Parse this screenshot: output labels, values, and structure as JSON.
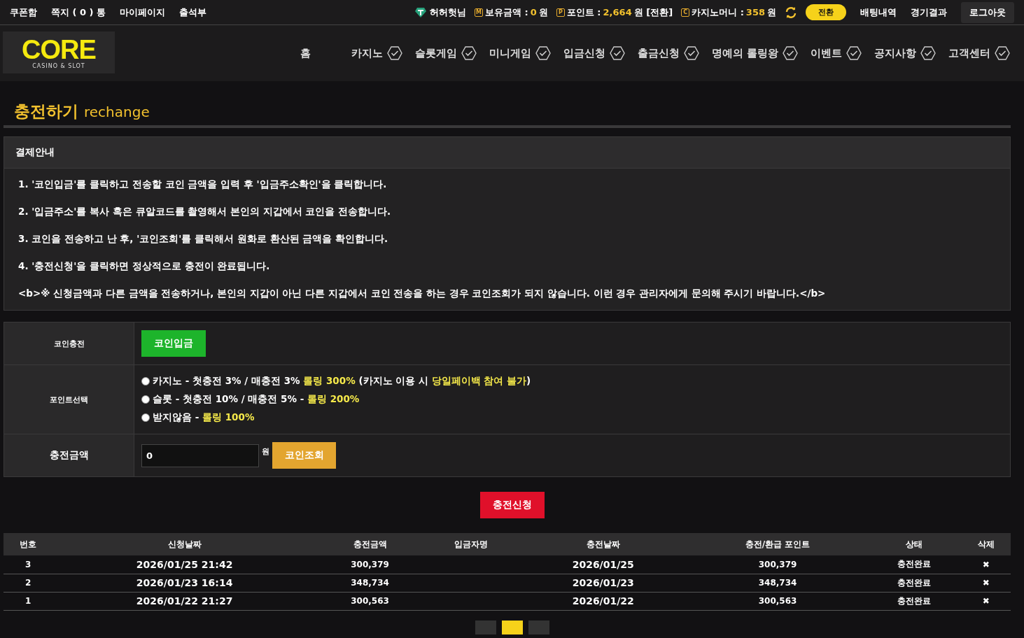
{
  "top_bar": {
    "left_links": [
      "쿠폰함",
      "쪽지 ( 0 ) 통",
      "마이페이지",
      "출석부"
    ],
    "user": {
      "name": "허허헛님"
    },
    "balances": [
      {
        "badge": "M",
        "label": "보유금액 :",
        "value": "0",
        "suffix": "원"
      },
      {
        "badge": "P",
        "label": "포인트 :",
        "value": "2,664",
        "suffix": "원 [전환]"
      },
      {
        "badge": "C",
        "label": "카지노머니 :",
        "value": "358",
        "suffix": "원"
      }
    ],
    "convert_button": "전환",
    "right_links": [
      "배팅내역",
      "경기결과"
    ],
    "logout_button": "로그아웃"
  },
  "logo": {
    "word": "CORE",
    "tagline": "CASINO & SLOT"
  },
  "nav": [
    {
      "label": "홈",
      "has_icon": false
    },
    {
      "label": "카지노",
      "has_icon": true
    },
    {
      "label": "슬롯게임",
      "has_icon": true
    },
    {
      "label": "미니게임",
      "has_icon": true
    },
    {
      "label": "입금신청",
      "has_icon": true
    },
    {
      "label": "출금신청",
      "has_icon": true
    },
    {
      "label": "명예의 롤링왕",
      "has_icon": true
    },
    {
      "label": "이벤트",
      "has_icon": true
    },
    {
      "label": "공지사항",
      "has_icon": true
    },
    {
      "label": "고객센터",
      "has_icon": true
    }
  ],
  "page_title": {
    "main": "충전하기",
    "sub": "rechange"
  },
  "guide": {
    "title": "결제안내",
    "lines": [
      "1. '코인입금'를 클릭하고 전송할 코인 금액을 입력 후 '입금주소확인'을 클릭합니다.",
      "2. '입금주소'를 복사 혹은 큐알코드를 촬영해서 본인의 지갑에서 코인을 전송합니다.",
      "3. 코인을 전송하고 난 후, '코인조회'를 클릭해서 원화로 환산된 금액을 확인합니다.",
      "4. '충전신청'을 클릭하면 정상적으로 충전이 완료됩니다.",
      "<b>※ 신청금액과 다른 금액을 전송하거나, 본인의 지갑이 아닌 다른 지갑에서 코인 전송을 하는 경우 코인조회가 되지 않습니다. 이런 경우 관리자에게 문의해 주시기 바랍니다.</b>"
    ]
  },
  "form": {
    "coin_label": "코인충전",
    "coin_button": "코인입금",
    "point_label": "포인트선택",
    "point_options": [
      {
        "selected": false,
        "parts": [
          {
            "text": "카지노 - 첫충전 3% / 매충전 3% ",
            "highlight": false
          },
          {
            "text": "롤링 300%",
            "highlight": true
          },
          {
            "text": " (카지노 이용 시 ",
            "highlight": false
          },
          {
            "text": "당일페이백 참여 불가",
            "highlight": true
          },
          {
            "text": ")",
            "highlight": false
          }
        ]
      },
      {
        "selected": false,
        "parts": [
          {
            "text": "슬롯 - 첫충전 10% / 매충전 5% - ",
            "highlight": false
          },
          {
            "text": "롤링 200%",
            "highlight": true
          }
        ]
      },
      {
        "selected": false,
        "parts": [
          {
            "text": "받지않음 - ",
            "highlight": false
          },
          {
            "text": "롤링 100%",
            "highlight": true
          }
        ]
      }
    ],
    "amount_label": "충전금액",
    "amount_value": "0",
    "amount_unit": "원",
    "lookup_button": "코인조회"
  },
  "submit_button": "충전신청",
  "history": {
    "columns": [
      "번호",
      "신청날짜",
      "충전금액",
      "입금자명",
      "충전날짜",
      "충전/환급 포인트",
      "상태",
      "삭제"
    ],
    "rows": [
      {
        "no": "3",
        "requested": "2026/01/25 21:42",
        "amount": "300,379",
        "charged": "2026/01/25",
        "points": "300,379",
        "status": "충전완료",
        "delete": "✖"
      },
      {
        "no": "2",
        "requested": "2026/01/23 16:14",
        "amount": "348,734",
        "charged": "2026/01/23",
        "points": "348,734",
        "status": "충전완료",
        "delete": "✖"
      },
      {
        "no": "1",
        "requested": "2026/01/22 21:27",
        "amount": "300,563",
        "charged": "2026/01/22",
        "points": "300,563",
        "status": "충전완료",
        "delete": "✖"
      }
    ]
  },
  "pagination": [
    {
      "selected": false
    },
    {
      "selected": true
    },
    {
      "selected": false
    }
  ]
}
